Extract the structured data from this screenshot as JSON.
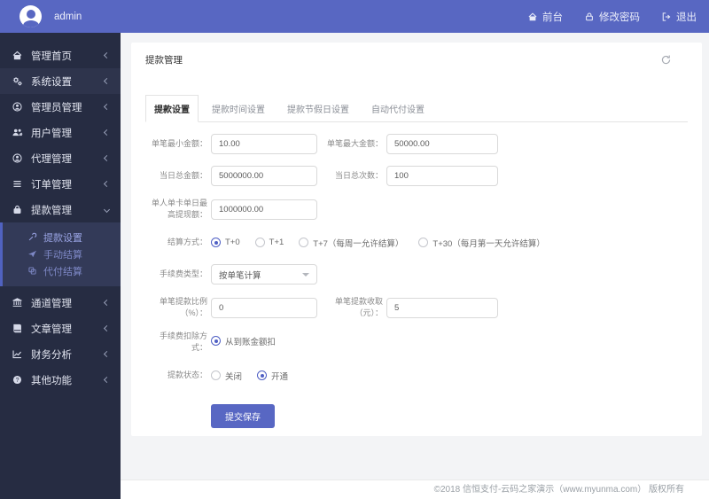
{
  "topbar": {
    "username": "admin",
    "nav": [
      {
        "label": "前台",
        "icon": "home-icon"
      },
      {
        "label": "修改密码",
        "icon": "lock-icon"
      },
      {
        "label": "退出",
        "icon": "sign-out-icon"
      }
    ]
  },
  "sidebar": {
    "items": [
      {
        "label": "管理首页",
        "icon": "home-icon"
      },
      {
        "label": "系统设置",
        "icon": "gears-icon"
      },
      {
        "label": "管理员管理",
        "icon": "user-circle-icon"
      },
      {
        "label": "用户管理",
        "icon": "users-icon"
      },
      {
        "label": "代理管理",
        "icon": "user-circle-icon"
      },
      {
        "label": "订单管理",
        "icon": "list-icon"
      },
      {
        "label": "提款管理",
        "icon": "lock-icon",
        "expanded": true,
        "children": [
          {
            "label": "提款设置",
            "icon": "wrench-icon",
            "active": true
          },
          {
            "label": "手动结算",
            "icon": "paper-plane-icon"
          },
          {
            "label": "代付结算",
            "icon": "clone-icon"
          }
        ]
      },
      {
        "label": "通道管理",
        "icon": "bank-icon"
      },
      {
        "label": "文章管理",
        "icon": "book-icon"
      },
      {
        "label": "财务分析",
        "icon": "chart-line-icon"
      },
      {
        "label": "其他功能",
        "icon": "question-circle-icon"
      }
    ]
  },
  "page": {
    "title": "提款管理"
  },
  "tabs": [
    "提款设置",
    "提款时间设置",
    "提款节假日设置",
    "自动代付设置"
  ],
  "form": {
    "min_amount": {
      "label": "单笔最小金额：",
      "value": "10.00"
    },
    "max_amount": {
      "label": "单笔最大金额：",
      "value": "50000.00"
    },
    "daily_total": {
      "label": "当日总金额：",
      "value": "5000000.00"
    },
    "daily_count": {
      "label": "当日总次数：",
      "value": "100"
    },
    "per_card_daily_max": {
      "label": "单人单卡单日最高提现额：",
      "value": "1000000.00"
    },
    "settlement": {
      "label": "结算方式：",
      "options": [
        "T+0",
        "T+1",
        "T+7（每周一允许结算）",
        "T+30（每月第一天允许结算）"
      ],
      "selected": "T+0"
    },
    "fee_type": {
      "label": "手续费类型：",
      "value": "按单笔计算"
    },
    "fee_percent": {
      "label": "单笔提款比例（%）：",
      "value": "0"
    },
    "fee_fixed": {
      "label": "单笔提款收取（元）：",
      "value": "5"
    },
    "fee_deduct": {
      "label": "手续费扣除方式：",
      "options": [
        "从到账金额扣"
      ],
      "selected": "从到账金额扣"
    },
    "status": {
      "label": "提款状态：",
      "options": [
        "关闭",
        "开通"
      ],
      "selected": "开通"
    },
    "submit_label": "提交保存"
  },
  "footer": {
    "copyright": "©2018 信恒支付-云码之家演示（www.myunma.com） 版权所有"
  },
  "colors": {
    "topbar": "#5867c2",
    "sidebar": "#262c42",
    "sidebar_hover": "#2e344c",
    "submenu_bg": "#333a58",
    "submenu_border": "#5062c0",
    "accent": "#5867c3",
    "submenu_link": "#7e88c6",
    "submenu_link_active": "#9aa4e4",
    "content_bg": "#f3f4f6"
  }
}
